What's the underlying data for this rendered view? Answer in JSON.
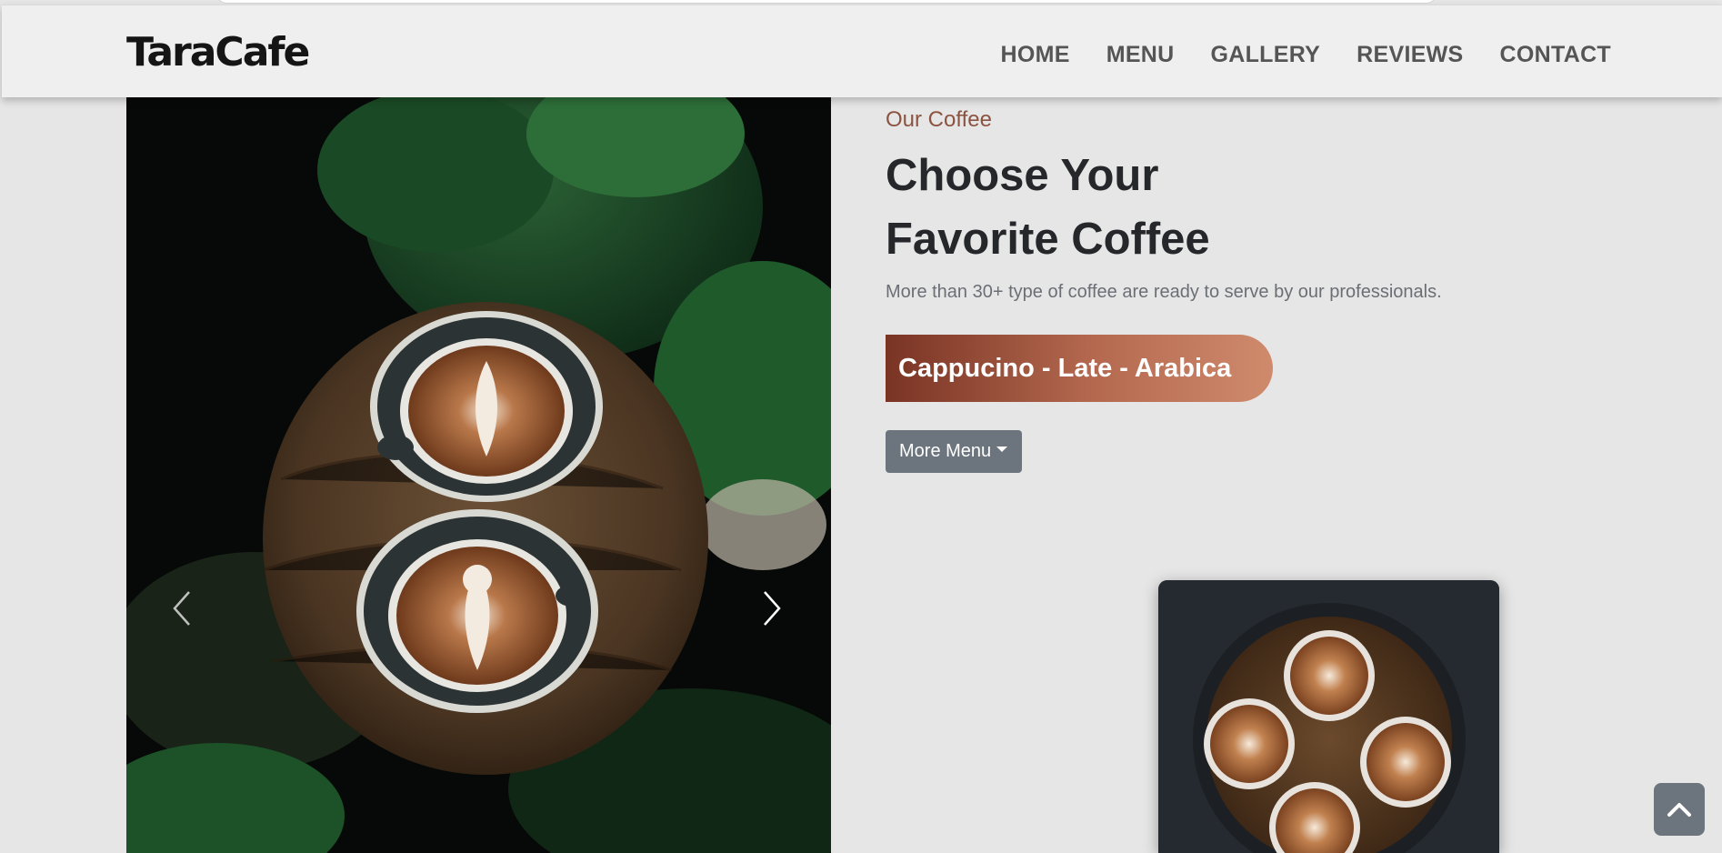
{
  "window": {
    "title": "TaraCafe"
  },
  "navbar": {
    "brand": "TaraCafe",
    "items": [
      {
        "label": "HOME"
      },
      {
        "label": "MENU"
      },
      {
        "label": "GALLERY"
      },
      {
        "label": "REVIEWS"
      },
      {
        "label": "CONTACT"
      }
    ]
  },
  "hero": {
    "eyebrow": "Our Coffee",
    "title_line1": "Choose Your",
    "title_line2": "Favorite Coffee",
    "description": "More than 30+ type of coffee are ready to serve by our professionals.",
    "highlight": "Cappucino - Late - Arabica",
    "dropdown_label": "More Menu"
  },
  "slider": {
    "image": "two-latte-art-cups-on-wooden-stool-with-plants",
    "prev_icon": "chevron-left-icon",
    "next_icon": "chevron-right-icon"
  },
  "card": {
    "image": "four-latte-cups-on-round-wooden-table"
  },
  "back_to_top": {
    "icon": "chevron-up-icon"
  },
  "colors": {
    "page_bg": "#e6e6e6",
    "navbar_bg": "#efefef",
    "accent_start": "#7a3424",
    "accent_end": "#cf8a6c",
    "eyebrow": "#8b5340",
    "button_gray": "#6c757d"
  }
}
